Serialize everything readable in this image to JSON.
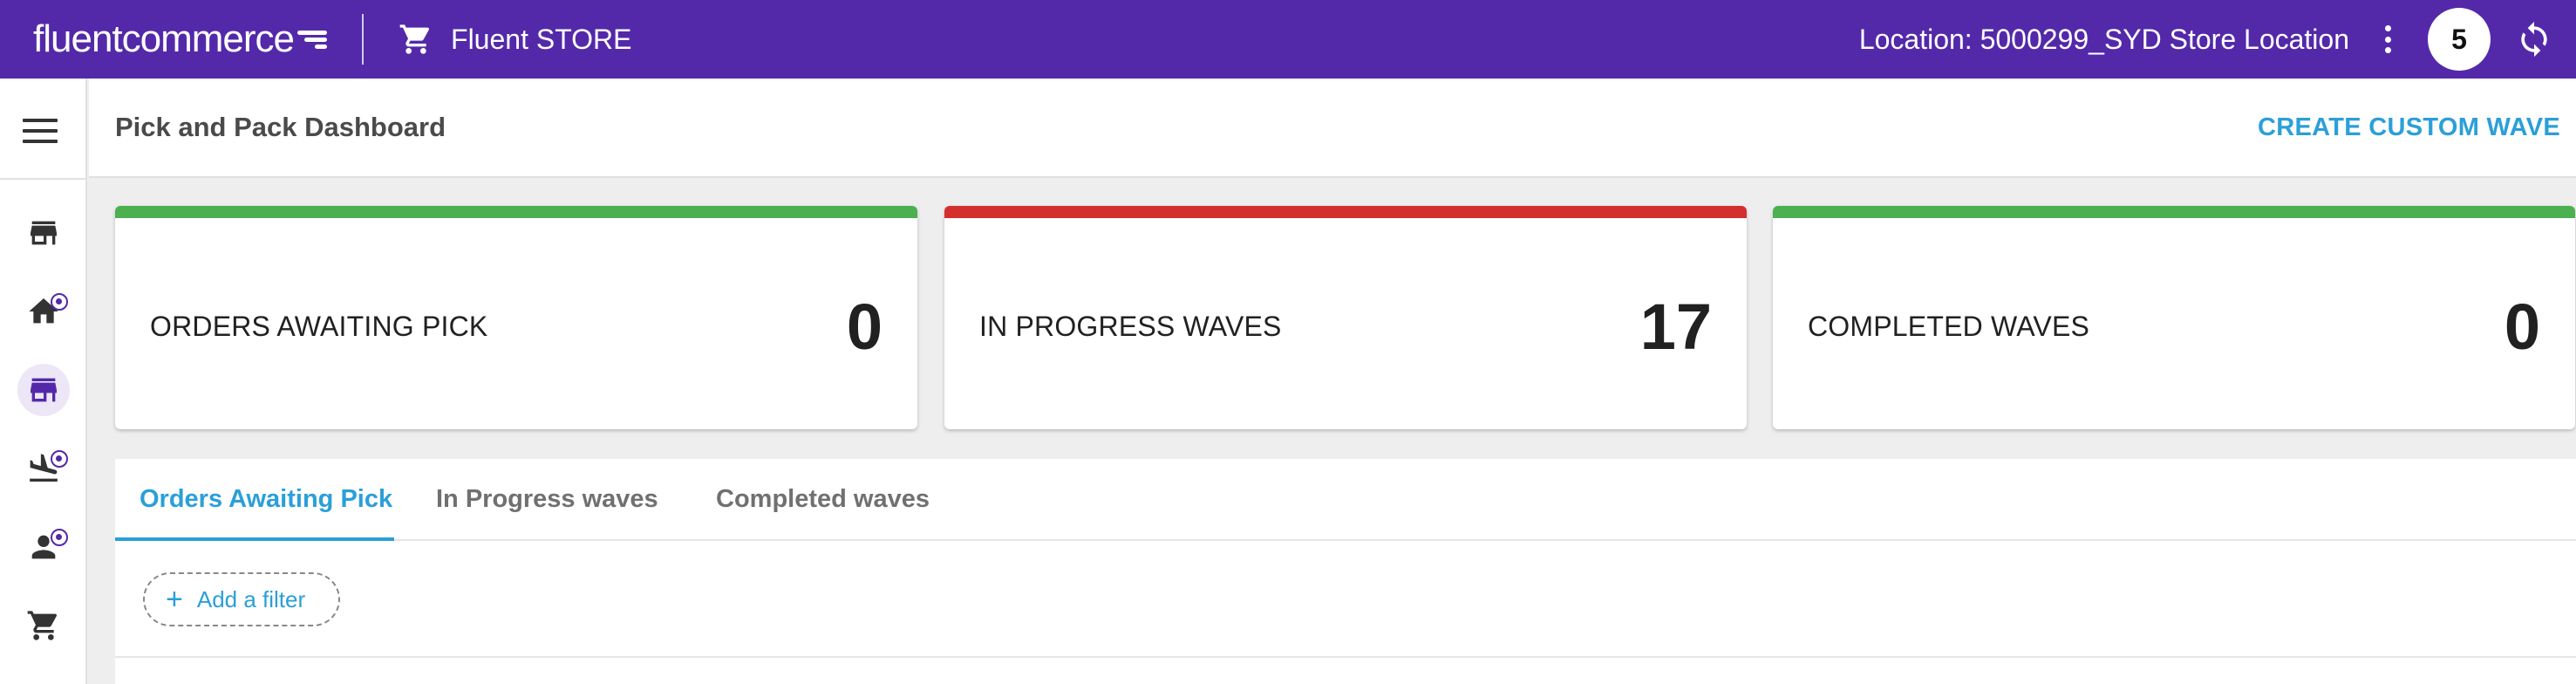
{
  "topbar": {
    "brand": {
      "part1": "fluent",
      "part2": "commerce"
    },
    "store_name": "Fluent STORE",
    "location": "Location: 5000299_SYD Store Location",
    "notification_count": "5",
    "background_color": "#5329a9"
  },
  "sidebar": {
    "items": [
      {
        "icon": "menu-icon"
      },
      {
        "icon": "store-icon"
      },
      {
        "icon": "home-icon",
        "badge": true
      },
      {
        "icon": "storefront-icon",
        "active": true
      },
      {
        "icon": "flight-land-icon",
        "badge": true
      },
      {
        "icon": "person-icon",
        "badge": true
      },
      {
        "icon": "cart-icon"
      }
    ]
  },
  "header": {
    "title": "Pick and Pack Dashboard",
    "action_label": "CREATE CUSTOM WAVE"
  },
  "cards": [
    {
      "label": "ORDERS AWAITING PICK",
      "value": "0",
      "color": "#4caf50"
    },
    {
      "label": "IN PROGRESS WAVES",
      "value": "17",
      "color": "#d32f2f"
    },
    {
      "label": "COMPLETED WAVES",
      "value": "0",
      "color": "#4caf50"
    }
  ],
  "tabs": [
    {
      "label": "Orders Awaiting Pick",
      "active": true
    },
    {
      "label": "In Progress waves",
      "active": false
    },
    {
      "label": "Completed waves",
      "active": false
    }
  ],
  "filter": {
    "label": "Add a filter"
  },
  "colors": {
    "accent": "#2b9fd8",
    "brand": "#5329a9",
    "success": "#4caf50",
    "danger": "#d32f2f"
  }
}
